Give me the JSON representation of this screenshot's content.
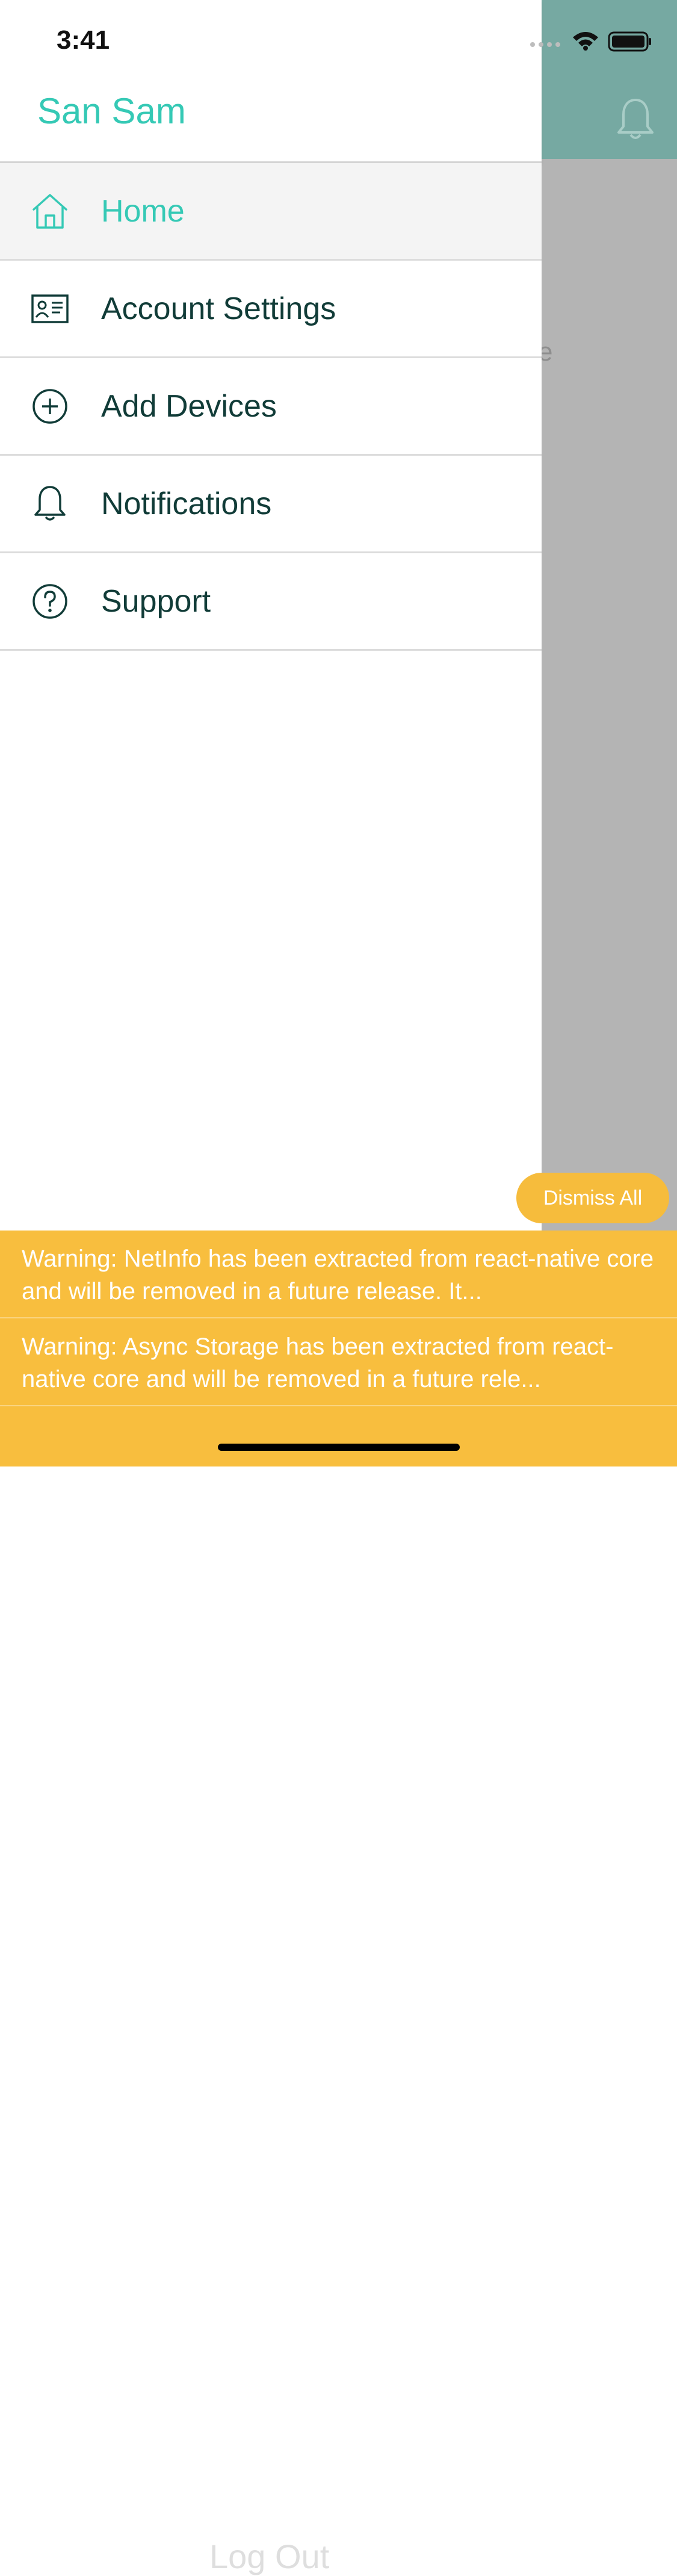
{
  "status_bar": {
    "time": "3:41"
  },
  "background": {
    "peek_text": "e",
    "bell_icon": "bell-icon"
  },
  "drawer": {
    "user_name": "San Sam",
    "menu": [
      {
        "label": "Home",
        "icon": "home-icon",
        "active": true
      },
      {
        "label": "Account Settings",
        "icon": "id-card-icon",
        "active": false
      },
      {
        "label": "Add Devices",
        "icon": "plus-circle-icon",
        "active": false
      },
      {
        "label": "Notifications",
        "icon": "bell-icon",
        "active": false
      },
      {
        "label": "Support",
        "icon": "question-circle-icon",
        "active": false
      }
    ],
    "logout_label": "Log Out"
  },
  "warnings": {
    "dismiss_all_label": "Dismiss All",
    "items": [
      "Warning: NetInfo has been extracted from react-native core and will be removed in a future release. It...",
      "Warning: Async Storage has been extracted from react-native core and will be removed in a future rele..."
    ]
  },
  "colors": {
    "accent": "#35c9b5",
    "header_bg": "#76a9a2",
    "dark_text": "#113c38",
    "warning_bg": "#f8be3e"
  }
}
